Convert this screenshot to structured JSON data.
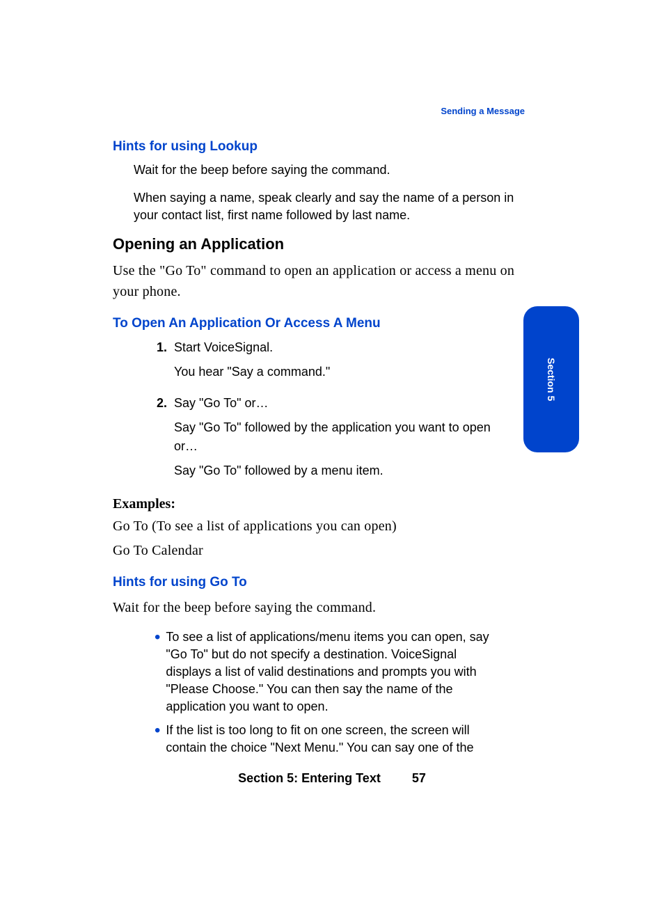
{
  "header": {
    "topic": "Sending a Message"
  },
  "sections": {
    "hints_lookup": {
      "title": "Hints for using Lookup",
      "p1": "Wait for the beep before saying the command.",
      "p2": "When saying a name, speak clearly and say the name of a person in your contact list, first name followed by last name."
    },
    "opening_app": {
      "title": "Opening an Application",
      "intro": "Use the \"Go To\" command to open an application or access a menu on your phone."
    },
    "to_open": {
      "title": "To Open An Application Or Access A Menu",
      "steps": [
        {
          "num": "1.",
          "main": "Start VoiceSignal.",
          "sub1": "You hear \"Say a command.\""
        },
        {
          "num": "2.",
          "main": "Say \"Go To\" or…",
          "sub1": "Say \"Go To\" followed by the application you want to open or…",
          "sub2": "Say \"Go To\" followed by a menu item."
        }
      ]
    },
    "examples": {
      "label": "Examples",
      "line1": "Go To  (To see a list of applications you can open)",
      "line2": "Go To Calendar"
    },
    "hints_goto": {
      "title": "Hints for using Go To",
      "intro": "Wait for the beep before saying the command.",
      "bullets": [
        "To see a list of applications/menu items you can open, say \"Go To\" but do not specify a destination. VoiceSignal displays a list of valid destinations and prompts you with \"Please Choose.\" You can then say the name of the application you want to open.",
        "If the list is too long to fit on one screen, the screen will contain the choice \"Next Menu.\" You can say one of the"
      ]
    }
  },
  "side_tab": {
    "label": "Section 5"
  },
  "footer": {
    "title": "Section 5: Entering Text",
    "page": "57"
  }
}
